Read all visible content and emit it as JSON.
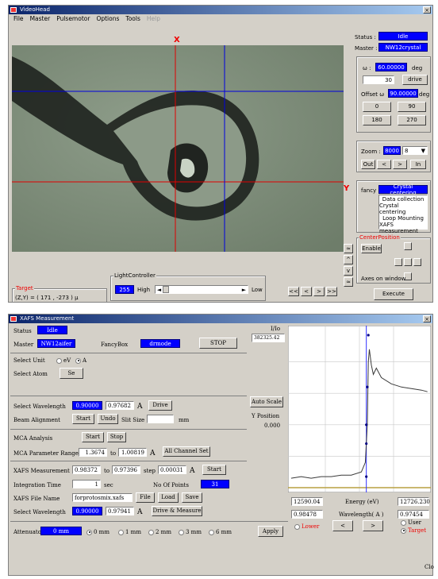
{
  "videohead": {
    "title": "VideoHead",
    "menu": [
      "File",
      "Master",
      "Pulsemotor",
      "Options",
      "Tools",
      "Help"
    ],
    "cross_x_label": "X",
    "cross_y_label": "Y",
    "status_label": "Status :",
    "status_value": "Idle",
    "master_label": "Master :",
    "master_value": "NW12crystal",
    "omega_label": "ω :",
    "omega_value": "60.00000",
    "omega_unit": "deg",
    "omega_step": "30",
    "drive_label": "drive",
    "offset_label": "Offset ω",
    "offset_value": "90.00000",
    "offset_unit": "deg",
    "angle_buttons": [
      "0",
      "90",
      "180",
      "270"
    ],
    "zoom_label": "Zoom :",
    "zoom_value": "8000",
    "zoom_select": "8",
    "zoom_out": "Out",
    "zoom_prev": "<",
    "zoom_next": ">",
    "zoom_in": "In",
    "fancy_label": "fancy :",
    "fancy_value": "Crystal centering",
    "fancy_options": [
      "Data collection",
      "Crystal centering",
      "Loop Mounting",
      "XAFS measurement"
    ],
    "center_position_label": "CenterPosition",
    "enable_label": "Enable",
    "axes_on_window_label": "Axes on window",
    "execute_label": "Execute",
    "target_label": "Target",
    "target_text": "(Z,Y) = (    171 ,   -273 ) μ",
    "light_controller_label": "LightController",
    "light_value": "255",
    "light_high": "High",
    "light_low": "Low",
    "nav_buttons": [
      "<<",
      "<",
      ">",
      ">>"
    ],
    "step_buttons": [
      "≈",
      "^",
      "v",
      "≈"
    ]
  },
  "xafs": {
    "title": "XAFS Measurement",
    "status_label": "Status",
    "status_value": "Idle",
    "master_label": "Master",
    "master_value": "NW12aifer",
    "fancybox_label": "FancyBox",
    "fancybox_value": "drmode",
    "stop_label": "STOP",
    "select_unit_label": "Select Unit",
    "unit_ev": "eV",
    "unit_a": "A",
    "select_atom_label": "Select Atom",
    "atom_value": "Se",
    "select_wavelength_label": "Select Wavelength",
    "wavelength_value": "0.90000",
    "wavelength_field": "0.97682",
    "wavelength_unit": "A",
    "drive_label": "Drive",
    "beam_alignment_label": "Beam Alignment",
    "start_label": "Start",
    "undo_label": "Undo",
    "slit_size_label": "Slit Size",
    "mm_label": "mm",
    "mca_analysis_label": "MCA Analysis",
    "mca_start": "Start",
    "mca_stop": "Stop",
    "mca_range_label": "MCA Parameter Range",
    "mca_range_from": "1.3674",
    "to_label": "to",
    "mca_range_to": "1.00819",
    "mca_unit": "A",
    "all_channel_label": "All Channel Set",
    "xafs_measurement_label": "XAFS Measurement",
    "xafs_from": "0.98372",
    "xafs_to": "0.97396",
    "step_label": "step",
    "xafs_step": "0.00031",
    "xafs_unit": "A",
    "xafs_start": "Start",
    "integration_time_label": "Integration Time",
    "integration_value": "1",
    "sec_label": "sec",
    "num_points_label": "No Of Points",
    "num_points_value": "31",
    "file_name_label": "XAFS File Name",
    "file_name_value": "forprotosmix.xafs",
    "file_button": "File",
    "load_button": "Load",
    "save_button": "Save",
    "select_wavelength2_label": "Select Wavelength",
    "wavelength2_value": "0.90000",
    "wavelength2_field": "0.97941",
    "wavelength2_unit": "A",
    "drive_measure_label": "Drive & Measure",
    "attenuator_label": "Attenuator",
    "attenuator_value": "0 mm",
    "attenuator_options": [
      "0 mm",
      "1 mm",
      "2 mm",
      "3 mm",
      "6 mm"
    ],
    "apply_label": "Apply",
    "io_label": "I/Io",
    "io_value": "382325.42",
    "auto_scale_label": "Auto Scale",
    "y_position_label": "Y Position",
    "y_position_value": "0.000",
    "energy_left": "12590.04",
    "energy_label": "Energy (eV)",
    "energy_right": "12726.230",
    "wave_left": "0.98478",
    "wavelength_axis_label": "Wavelength( A )",
    "wave_right": "0.97454",
    "lower_label": "Lower",
    "nav_prev": "<",
    "nav_next": ">",
    "user_label": "User",
    "target_label": "Target",
    "close_btn": "Clo"
  },
  "chart_data": {
    "type": "line",
    "x": [
      12590,
      12600,
      12610,
      12620,
      12630,
      12640,
      12650,
      12660,
      12664,
      12666,
      12667,
      12668,
      12670,
      12672,
      12675,
      12680,
      12690,
      12700,
      12710,
      12720,
      12726
    ],
    "y": [
      0.06,
      0.07,
      0.06,
      0.07,
      0.07,
      0.08,
      0.08,
      0.1,
      0.16,
      0.4,
      0.8,
      0.88,
      0.78,
      0.72,
      0.76,
      0.7,
      0.66,
      0.64,
      0.63,
      0.62,
      0.61
    ],
    "points": [
      [
        12665,
        0.07
      ],
      [
        12665,
        0.28
      ],
      [
        12665,
        0.4
      ],
      [
        12666,
        0.64
      ],
      [
        12667,
        0.97
      ]
    ],
    "xlim": [
      12590.04,
      12726.23
    ],
    "ylim": [
      0,
      1
    ],
    "grid": true,
    "colors": {
      "line": "#3a3a3a",
      "marker": "#000080",
      "vline": "#3030ff",
      "base": "#b8a040"
    }
  }
}
